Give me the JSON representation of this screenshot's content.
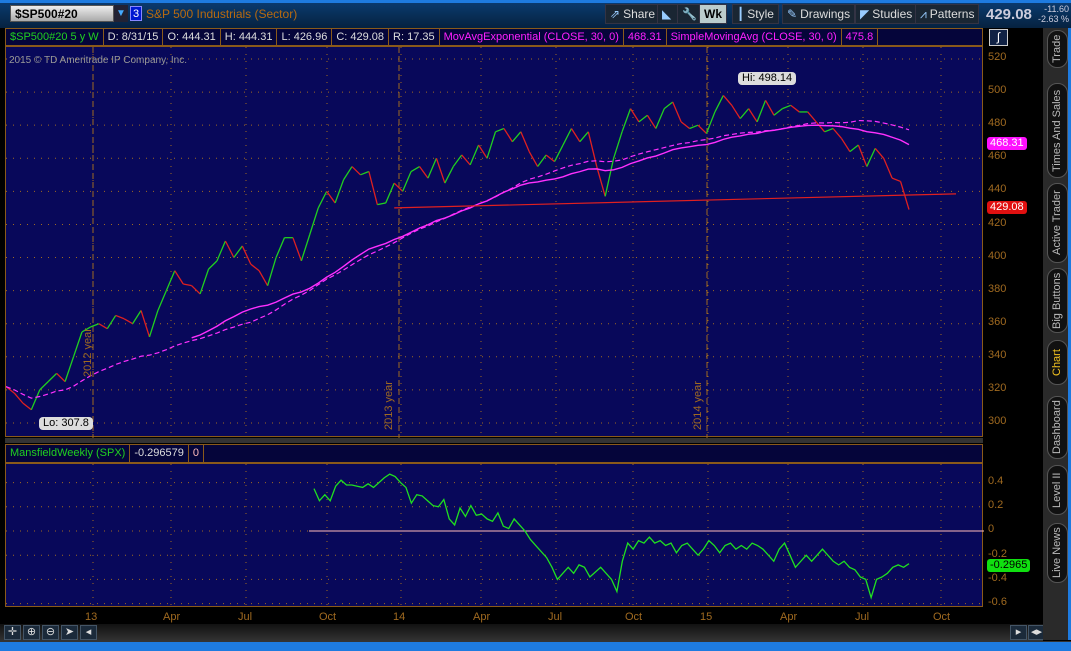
{
  "header": {
    "symbol": "$SP500#20",
    "link_number": "3",
    "description": "S&P 500 Industrials (Sector)",
    "share": "Share",
    "wk": "Wk",
    "style": "Style",
    "drawings": "Drawings",
    "studies": "Studies",
    "patterns": "Patterns",
    "last": "429.08",
    "change": "-11.60",
    "change_pct": "-2.63 %"
  },
  "legend": {
    "symbol_period": "$SP500#20 5 y W",
    "date": "D: 8/31/15",
    "open": "O: 444.31",
    "high": "H: 444.31",
    "low": "L: 426.96",
    "close": "C: 429.08",
    "range": "R: 17.35",
    "ema_label": "MovAvgExponential (CLOSE, 30, 0)",
    "ema_value": "468.31",
    "sma_label": "SimpleMovingAvg (CLOSE, 30, 0)",
    "sma_value": "475.8"
  },
  "copyright": "2015 © TD Ameritrade IP Company, Inc.",
  "lower_legend": {
    "label": "MansfieldWeekly (SPX)",
    "value": "-0.296579",
    "zero": "0"
  },
  "badges": {
    "ema": "468.31",
    "close": "429.08",
    "mansfield": "-0.2965"
  },
  "annotations": {
    "hi": "Hi: 498.14",
    "lo": "Lo: 307.8",
    "years": [
      "2012 year",
      "2013 year",
      "2014 year"
    ]
  },
  "y_ticks": [
    "520",
    "500",
    "480",
    "460",
    "440",
    "420",
    "400",
    "380",
    "360",
    "340",
    "320",
    "300"
  ],
  "lower_ticks": [
    "0.4",
    "0.2",
    "0",
    "-0.2",
    "-0.4",
    "-0.6"
  ],
  "x_ticks": [
    "13",
    "Apr",
    "Jul",
    "Oct",
    "14",
    "Apr",
    "Jul",
    "Oct",
    "15",
    "Apr",
    "Jul",
    "Oct"
  ],
  "tabs": [
    "Trade",
    "Times And Sales",
    "Active Trader",
    "Big Buttons",
    "Chart",
    "Dashboard",
    "Level II",
    "Live News"
  ],
  "colors": {
    "up": "#20d020",
    "down": "#e02020",
    "ma": "#ff30ff",
    "mansfield": "#20e020",
    "trend": "#e02020"
  },
  "chart_data": [
    {
      "type": "line",
      "title": "$SP500#20 weekly close",
      "ylim": [
        295,
        525
      ],
      "closes": [
        322,
        318,
        312,
        308,
        320,
        325,
        330,
        325,
        340,
        355,
        358,
        360,
        357,
        365,
        363,
        360,
        368,
        352,
        368,
        380,
        392,
        384,
        383,
        378,
        393,
        398,
        410,
        400,
        407,
        396,
        392,
        383,
        400,
        412,
        412,
        398,
        414,
        430,
        440,
        433,
        447,
        455,
        450,
        452,
        432,
        433,
        445,
        440,
        452,
        455,
        448,
        460,
        445,
        455,
        462,
        456,
        468,
        460,
        476,
        478,
        470,
        476,
        464,
        455,
        462,
        458,
        468,
        478,
        470,
        476,
        455,
        437,
        460,
        476,
        490,
        482,
        486,
        478,
        490,
        494,
        482,
        478,
        480,
        475,
        488,
        498,
        492,
        484,
        490,
        482,
        495,
        486,
        490,
        492,
        488,
        488,
        482,
        476,
        478,
        472,
        464,
        468,
        455,
        466,
        460,
        448,
        446,
        429
      ],
      "ema_period": 30,
      "sma_period": 30,
      "trendline": {
        "from_index": 46,
        "from_value": 430,
        "to_value": 438.5
      }
    },
    {
      "type": "line",
      "title": "MansfieldWeekly (SPX)",
      "ylim": [
        -0.62,
        0.55
      ],
      "values": [
        0.35,
        0.25,
        0.3,
        0.25,
        0.37,
        0.42,
        0.38,
        0.38,
        0.37,
        0.36,
        0.39,
        0.36,
        0.4,
        0.44,
        0.47,
        0.45,
        0.4,
        0.36,
        0.23,
        0.3,
        0.29,
        0.25,
        0.21,
        0.2,
        0.26,
        0.1,
        0.05,
        0.19,
        0.12,
        0.21,
        0.13,
        0.14,
        0.1,
        0.08,
        0.15,
        0.04,
        0.02,
        0.1,
        0.05,
        0.0,
        -0.07,
        -0.12,
        -0.17,
        -0.22,
        -0.3,
        -0.4,
        -0.35,
        -0.3,
        -0.35,
        -0.28,
        -0.3,
        -0.38,
        -0.34,
        -0.3,
        -0.35,
        -0.4,
        -0.5,
        -0.25,
        -0.1,
        -0.15,
        -0.08,
        -0.1,
        -0.05,
        -0.1,
        -0.08,
        -0.12,
        -0.1,
        -0.18,
        -0.12,
        -0.1,
        -0.15,
        -0.2,
        -0.15,
        -0.08,
        -0.12,
        -0.18,
        -0.12,
        -0.1,
        -0.15,
        -0.12,
        -0.15,
        -0.1,
        -0.12,
        -0.15,
        -0.2,
        -0.25,
        -0.15,
        -0.1,
        -0.2,
        -0.3,
        -0.25,
        -0.2,
        -0.25,
        -0.2,
        -0.15,
        -0.2,
        -0.25,
        -0.28,
        -0.25,
        -0.3,
        -0.32,
        -0.38,
        -0.4,
        -0.55,
        -0.4,
        -0.38,
        -0.35,
        -0.3,
        -0.28,
        -0.3,
        -0.27
      ],
      "zero_line": 0
    }
  ]
}
